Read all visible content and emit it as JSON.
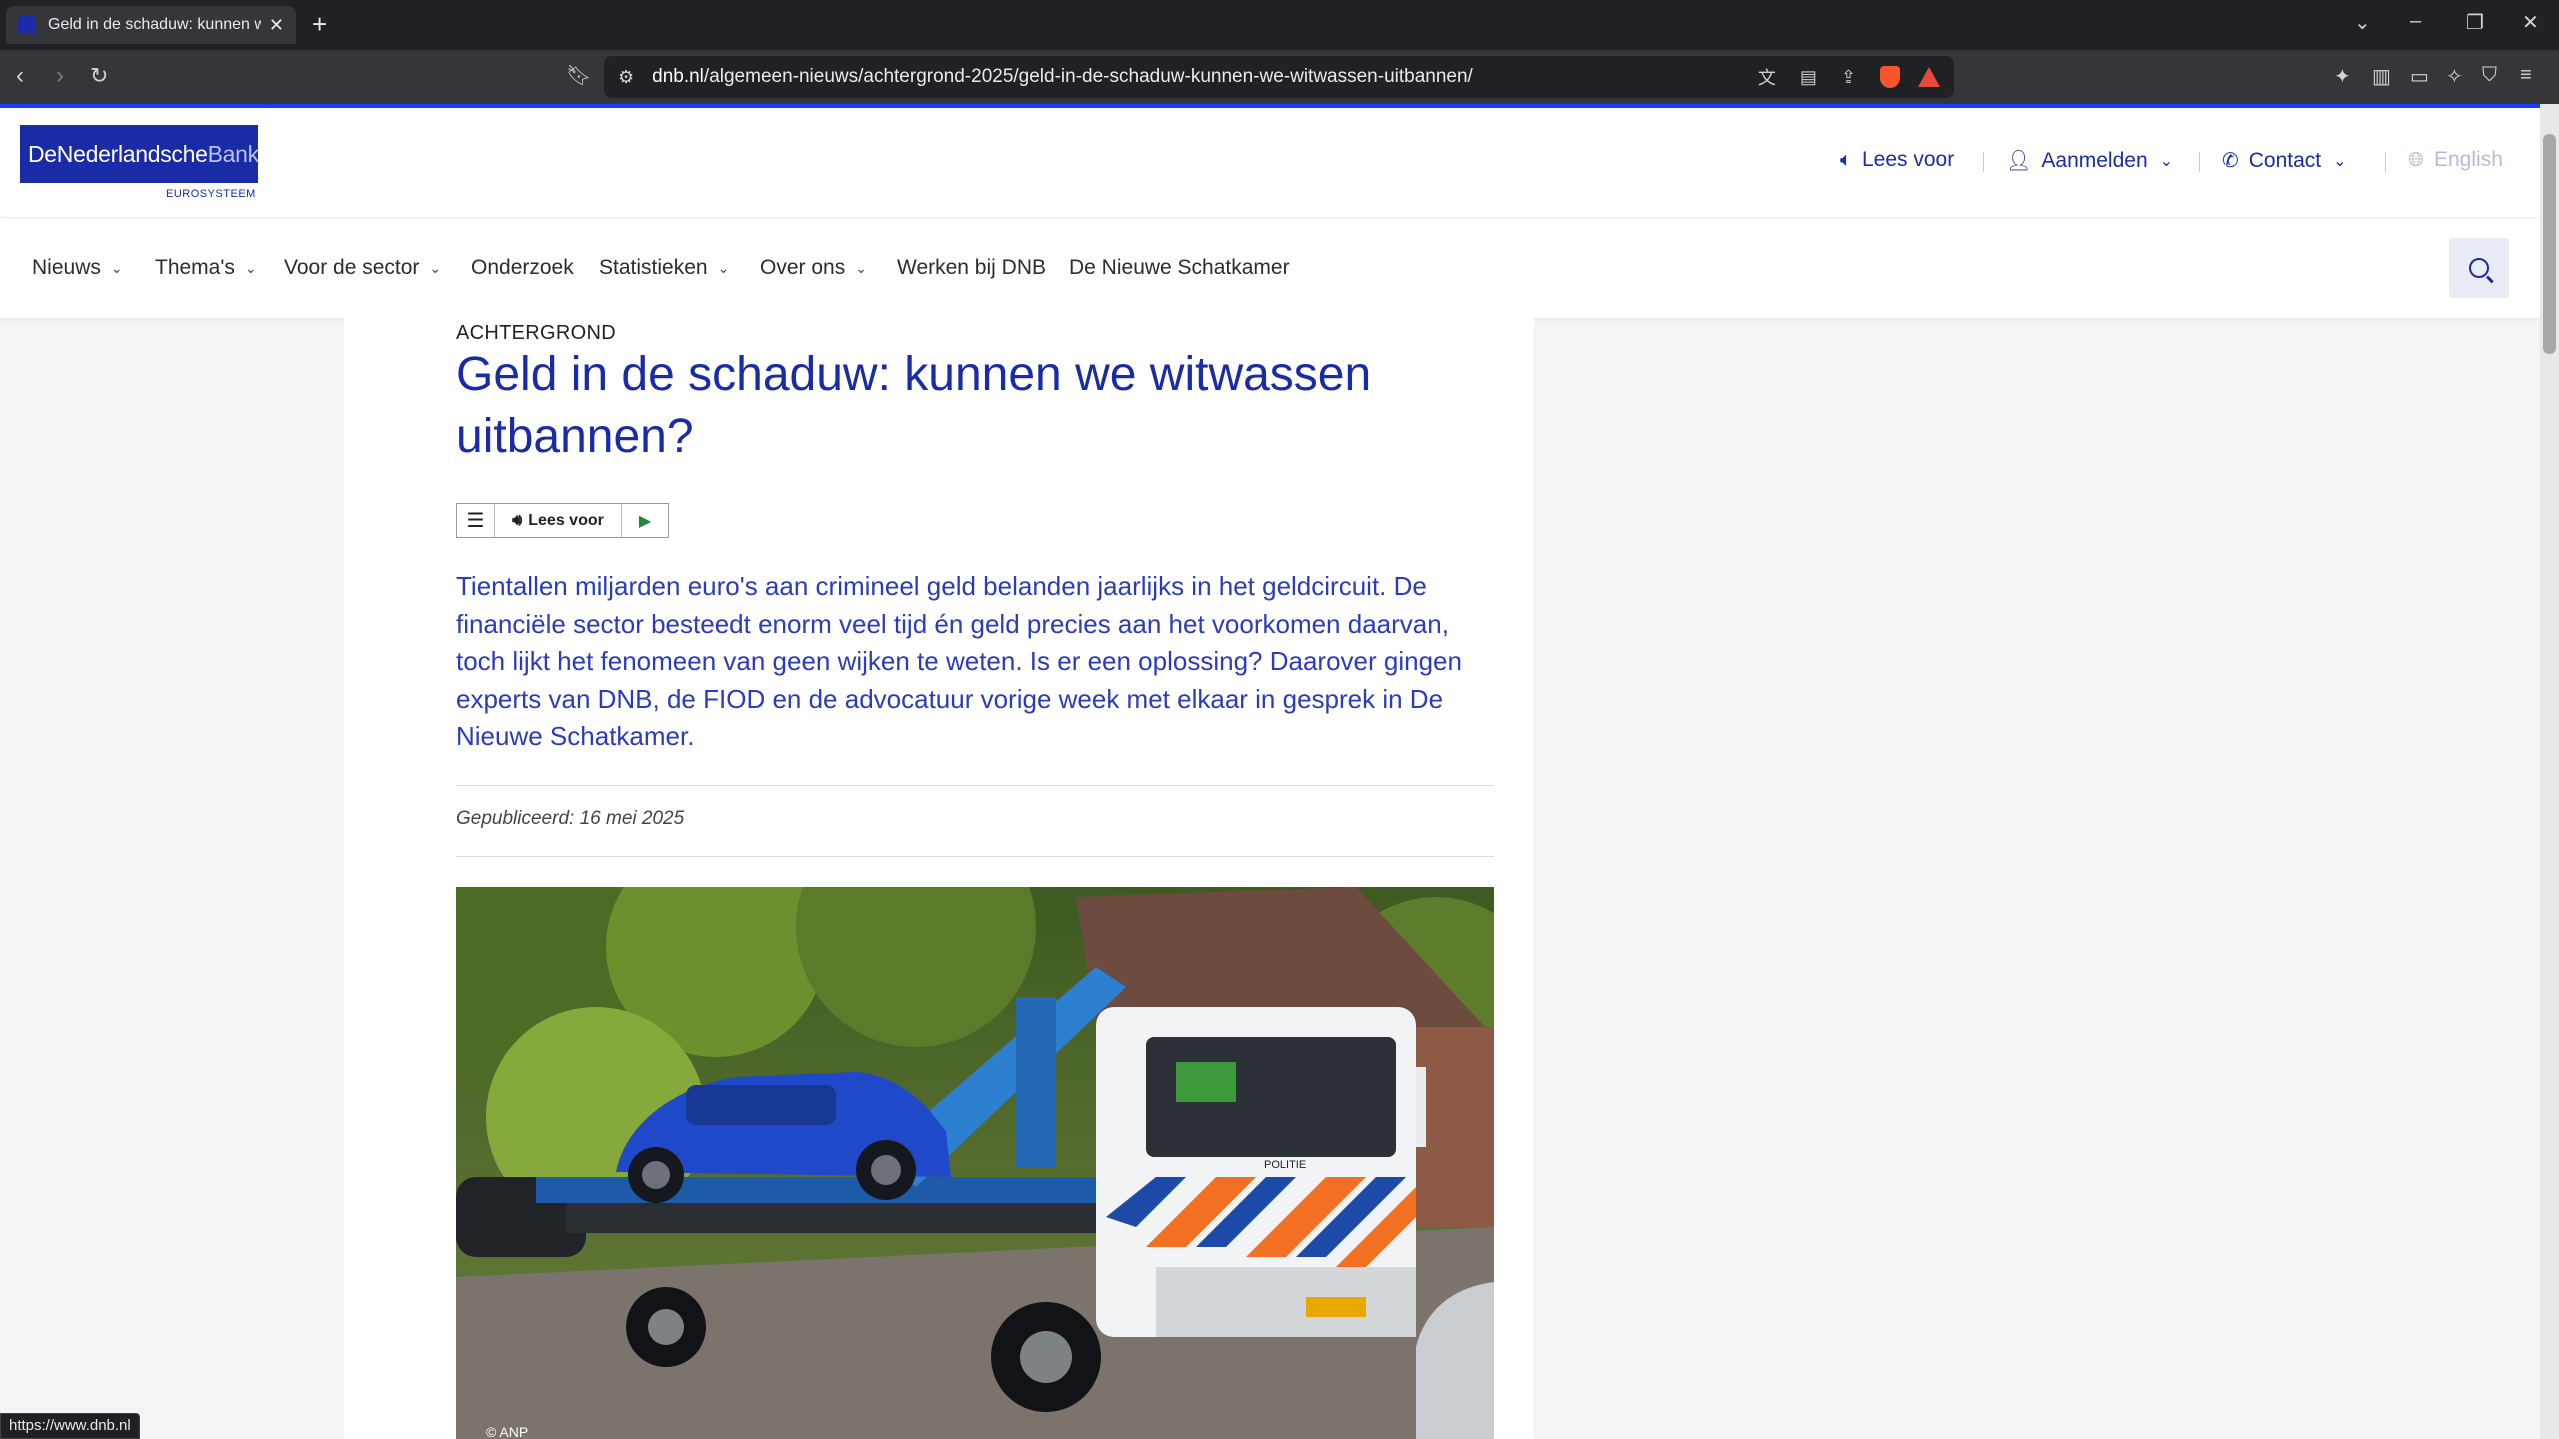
{
  "browser": {
    "tab_title": "Geld in de schaduw: kunnen we witwassen uitbannen?",
    "url_domain": "dnb.nl",
    "url_path": "/algemeen-nieuws/achtergrond-2025/geld-in-de-schaduw-kunnen-we-witwassen-uitbannen/",
    "status_url": "https://www.dnb.nl",
    "icons": [
      "back-icon",
      "forward-icon",
      "reload-icon",
      "bookmark-icon",
      "site-settings-icon",
      "translate-icon",
      "reader-icon",
      "share-icon",
      "brave-shield-icon",
      "rewards-icon",
      "extensions-icon",
      "sidebar-icon",
      "wallet-icon",
      "leo-icon",
      "vpn-icon",
      "menu-icon"
    ]
  },
  "site": {
    "logo_text_a": "DeNederlandsche",
    "logo_text_b": "Bank",
    "logo_sub": "EUROSYSTEEM",
    "brand_color": "#1a2ba8",
    "util": {
      "lees_voor": "Lees voor",
      "aanmelden": "Aanmelden",
      "contact": "Contact",
      "english": "English"
    },
    "nav": {
      "nieuws": "Nieuws",
      "themas": "Thema's",
      "sector": "Voor de sector",
      "onderzoek": "Onderzoek",
      "statistieken": "Statistieken",
      "over": "Over ons",
      "werken": "Werken bij DNB",
      "schatkamer": "De Nieuwe Schatkamer"
    }
  },
  "article": {
    "kicker": "ACHTERGROND",
    "title": "Geld in de schaduw: kunnen we witwassen uitbannen?",
    "readspeaker_label": "Lees voor",
    "intro": "Tientallen miljarden euro's aan crimineel geld belanden jaarlijks in het geldcircuit. De financiële sector besteedt enorm veel tijd én geld precies aan het voorkomen daarvan, toch lijkt het fenomeen van geen wijken te weten. Is er een oplossing? Daarover gingen experts van DNB, de FIOD en de advocatuur vorige week met elkaar in gesprek in De Nieuwe Schatkamer.",
    "published_label": "Gepubliceerd:",
    "published_date": "16 mei 2025",
    "photo_credit": "© ANP",
    "truck_label": "POLITIE"
  }
}
